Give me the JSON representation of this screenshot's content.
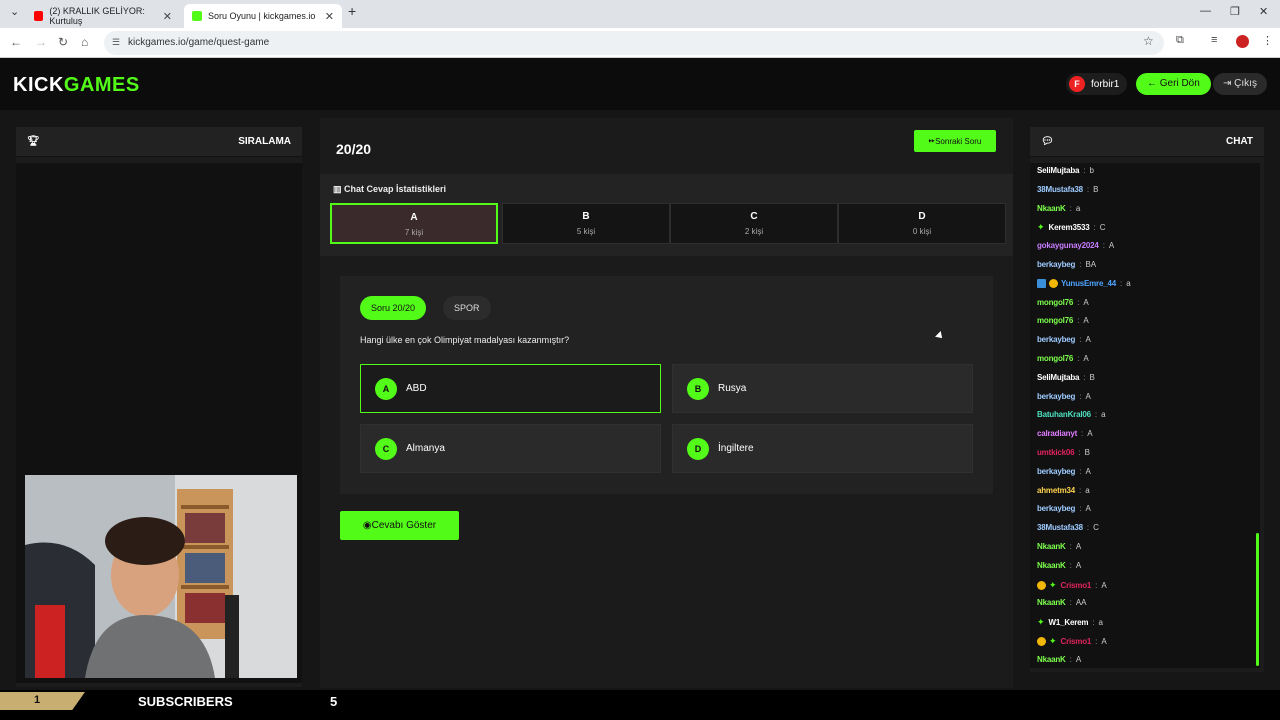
{
  "browser": {
    "tab1": "(2) KRALLIK GELİYOR: Kurtuluş",
    "tab2": "Soru Oyunu | kickgames.io",
    "url": "kickgames.io/game/quest-game"
  },
  "header": {
    "logo_kick": "KICK",
    "logo_games": "GAMES",
    "username": "forbir1",
    "back": "Geri Dön",
    "logout": "Çıkış"
  },
  "left": {
    "title": "SIRALAMA"
  },
  "question": {
    "counter": "20/20",
    "next": "Sonraki Soru",
    "stats_title": "Chat Cevap İstatistikleri",
    "stats": [
      {
        "letter": "A",
        "count": "7 kişi"
      },
      {
        "letter": "B",
        "count": "5 kişi"
      },
      {
        "letter": "C",
        "count": "2 kişi"
      },
      {
        "letter": "D",
        "count": "0 kişi"
      }
    ],
    "pill": "Soru 20/20",
    "category": "SPOR",
    "text": "Hangi ülke en çok Olimpiyat madalyası kazanmıştır?",
    "options": [
      {
        "letter": "A",
        "text": "ABD"
      },
      {
        "letter": "B",
        "text": "Rusya"
      },
      {
        "letter": "C",
        "text": "Almanya"
      },
      {
        "letter": "D",
        "text": "İngiltere"
      }
    ],
    "show": "Cevabı Göster"
  },
  "chat": {
    "title": "CHAT",
    "messages": [
      {
        "user": "SeliMujtaba",
        "text": "b",
        "color": "#ffffff"
      },
      {
        "user": "38Mustafa38",
        "text": "B",
        "color": "#9ecbff"
      },
      {
        "user": "NkaanK",
        "text": "a",
        "color": "#7cff4d"
      },
      {
        "user": "Kerem3533",
        "text": "C",
        "color": "#ffffff"
      },
      {
        "user": "gokaygunay2024",
        "text": "A",
        "color": "#c77dff"
      },
      {
        "user": "berkaybeg",
        "text": "BA",
        "color": "#9ecbff"
      },
      {
        "user": "YunusEmre_44",
        "text": "a",
        "color": "#4da3ff"
      },
      {
        "user": "mongol76",
        "text": "A",
        "color": "#7cff4d"
      },
      {
        "user": "mongol76",
        "text": "A",
        "color": "#7cff4d"
      },
      {
        "user": "berkaybeg",
        "text": "A",
        "color": "#9ecbff"
      },
      {
        "user": "mongol76",
        "text": "A",
        "color": "#7cff4d"
      },
      {
        "user": "SeliMujtaba",
        "text": "B",
        "color": "#ffffff"
      },
      {
        "user": "berkaybeg",
        "text": "A",
        "color": "#9ecbff"
      },
      {
        "user": "BatuhanKral06",
        "text": "a",
        "color": "#4de0c0"
      },
      {
        "user": "calradianyt",
        "text": "A",
        "color": "#e07dff"
      },
      {
        "user": "umtkick06",
        "text": "B",
        "color": "#e0245e"
      },
      {
        "user": "berkaybeg",
        "text": "A",
        "color": "#9ecbff"
      },
      {
        "user": "ahmetm34",
        "text": "a",
        "color": "#ffd24d"
      },
      {
        "user": "berkaybeg",
        "text": "A",
        "color": "#9ecbff"
      },
      {
        "user": "38Mustafa38",
        "text": "C",
        "color": "#9ecbff"
      },
      {
        "user": "NkaanK",
        "text": "A",
        "color": "#7cff4d"
      },
      {
        "user": "NkaanK",
        "text": "A",
        "color": "#7cff4d"
      },
      {
        "user": "Crismo1",
        "text": "A",
        "color": "#e0245e"
      },
      {
        "user": "NkaanK",
        "text": "AA",
        "color": "#7cff4d"
      },
      {
        "user": "W1_Kerem",
        "text": "a",
        "color": "#ffffff"
      },
      {
        "user": "Crismo1",
        "text": "A",
        "color": "#e0245e"
      },
      {
        "user": "NkaanK",
        "text": "A",
        "color": "#7cff4d"
      }
    ]
  },
  "footer": {
    "rank": "1",
    "label": "SUBSCRIBERS",
    "count": "5"
  },
  "colors": {
    "accent": "#53fc18"
  }
}
